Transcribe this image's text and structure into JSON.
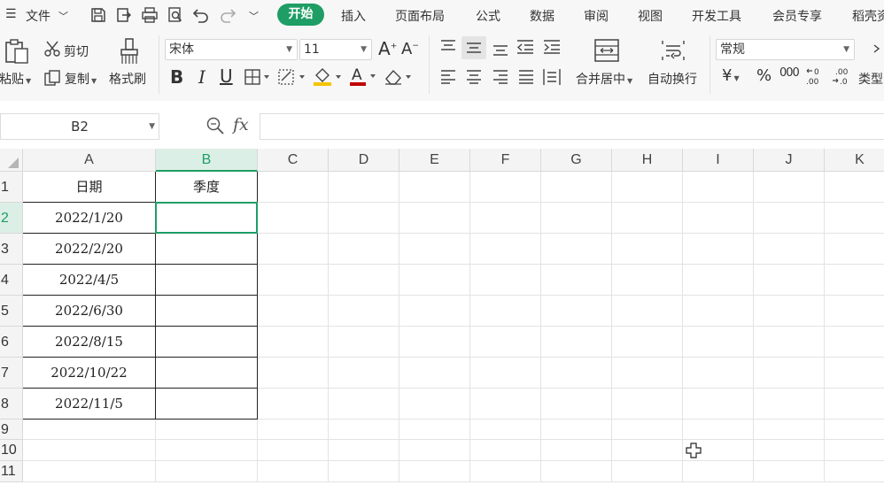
{
  "menu": {
    "file_label": "文件",
    "tabs": [
      "开始",
      "插入",
      "页面布局",
      "公式",
      "数据",
      "审阅",
      "视图",
      "开发工具",
      "会员专享",
      "稻壳资"
    ]
  },
  "ribbon": {
    "paste": "粘贴",
    "cut": "剪切",
    "copy": "复制",
    "format_painter": "格式刷",
    "font_name": "宋体",
    "font_size": "11",
    "merge_center": "合并居中",
    "wrap_text": "自动换行",
    "number_format": "常规",
    "currency_symbol": "¥",
    "percent_symbol": "%",
    "thousands_symbol": "000",
    "type_label": "类型"
  },
  "formula_bar": {
    "cell_ref": "B2",
    "fx": "fx",
    "value": ""
  },
  "sheet": {
    "columns": [
      "A",
      "B",
      "C",
      "D",
      "E",
      "F",
      "G",
      "H",
      "I",
      "J",
      "K"
    ],
    "rows": [
      "1",
      "2",
      "3",
      "4",
      "5",
      "6",
      "7",
      "8",
      "9",
      "10",
      "11"
    ],
    "header_row": [
      "日期",
      "季度"
    ],
    "dates": [
      "2022/1/20",
      "2022/2/20",
      "2022/4/5",
      "2022/6/30",
      "2022/8/15",
      "2022/10/22",
      "2022/11/5"
    ],
    "active_cell": "B2"
  },
  "colors": {
    "accent": "#1e9e64",
    "header_bg": "#f4f4f4",
    "active_header_bg": "#dcefe6"
  }
}
